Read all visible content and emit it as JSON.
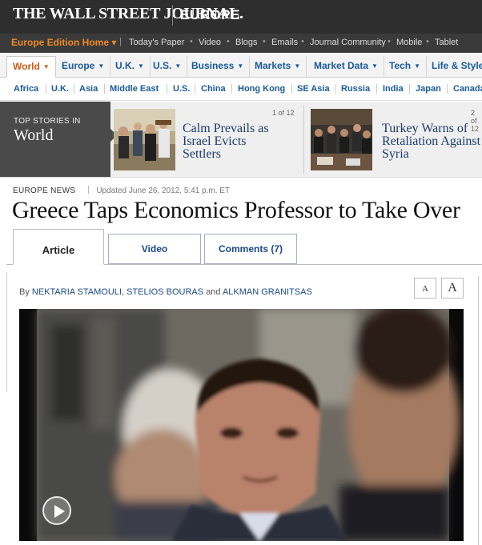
{
  "masthead": {
    "logo": "THE WALL STREET JOURNAL.",
    "edition": "EUROPE"
  },
  "utility_bar": {
    "home": "Europe Edition Home ▾",
    "links": [
      "Today's Paper",
      "Video",
      "Blogs",
      "Emails",
      "Journal Community",
      "Mobile",
      "Tablet"
    ]
  },
  "sections": [
    {
      "label": "World"
    },
    {
      "label": "Europe"
    },
    {
      "label": "U.K."
    },
    {
      "label": "U.S."
    },
    {
      "label": "Business"
    },
    {
      "label": "Markets"
    },
    {
      "label": "Market Data"
    },
    {
      "label": "Tech"
    },
    {
      "label": "Life & Style"
    }
  ],
  "subnav": [
    "Africa",
    "U.K.",
    "Asia",
    "Middle East",
    "U.S.",
    "China",
    "Hong Kong",
    "SE Asia",
    "Russia",
    "India",
    "Japan",
    "Canada"
  ],
  "top_stories": {
    "label_small": "TOP STORIES IN",
    "label_large": "World",
    "stories": [
      {
        "headline_lines": [
          "Calm Prevails as",
          "Israel Evicts",
          "Settlers"
        ],
        "count": "1 of 12"
      },
      {
        "headline_lines": [
          "Turkey Warns of",
          "Retaliation Against",
          "Syria"
        ],
        "count": "2 of 12"
      }
    ]
  },
  "article": {
    "kicker": "EUROPE NEWS",
    "updated": "Updated June 26, 2012, 5:41 p.m. ET",
    "headline": "Greece Taps Economics Professor to Take Over",
    "tabs": [
      "Article",
      "Video",
      "Comments (7)"
    ],
    "byline": {
      "prefix": "By",
      "authors": [
        "NEKTARIA STAMOULI",
        "STELIOS BOURAS",
        "ALKMAN GRANITSAS"
      ],
      "comma": ",",
      "and": "and"
    },
    "font_small": "A",
    "font_large": "A"
  },
  "colors": {
    "masthead_bg": "#2e2e2e",
    "accent_orange": "#d05a14",
    "link_blue": "#1a4a8a"
  }
}
